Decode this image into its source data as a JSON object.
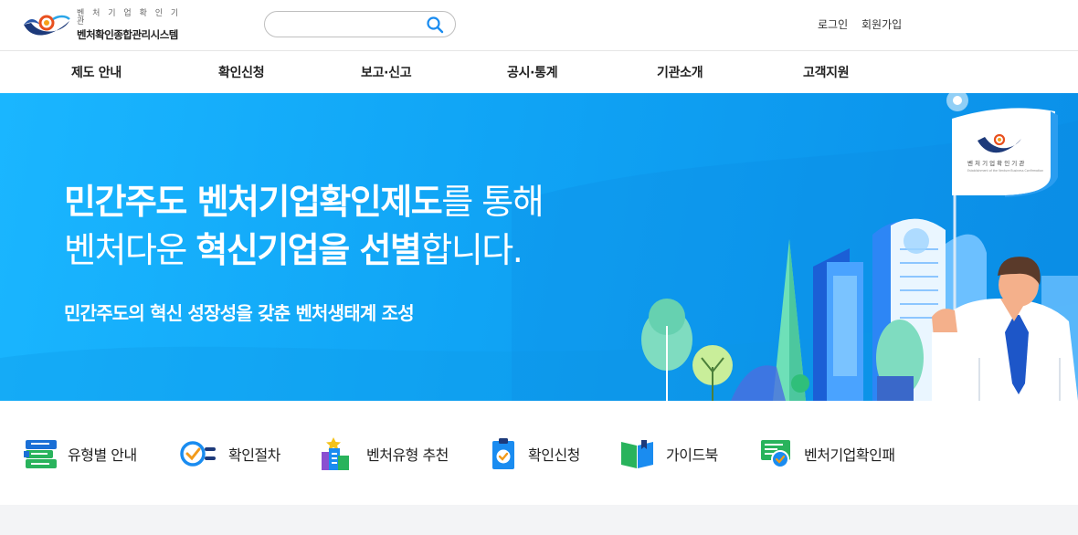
{
  "header": {
    "logo": {
      "subtitle": "벤 처 기 업 확 인 기 관",
      "title": "벤처확인종합관리시스템"
    },
    "search": {
      "placeholder": "",
      "value": ""
    },
    "util": {
      "login": "로그인",
      "signup": "회원가입"
    }
  },
  "nav": {
    "items": [
      {
        "label": "제도 안내"
      },
      {
        "label": "확인신청"
      },
      {
        "label": "보고·신고"
      },
      {
        "label": "공시·통계"
      },
      {
        "label": "기관소개"
      },
      {
        "label": "고객지원"
      }
    ]
  },
  "banner": {
    "line1_bold": "민간주도 벤처기업확인제도",
    "line1_rest": "를 통해",
    "line2_start": "벤처다운 ",
    "line2_bold": "혁신기업을 선별",
    "line2_rest": "합니다.",
    "subline": "민간주도의 혁신 성장성을 갖춘 벤처생태계 조성",
    "flag": {
      "org": "벤 처 기 업 확 인 기 관",
      "caption": "Establishment of the Venture Business Confirmation"
    }
  },
  "quick_menu": {
    "items": [
      {
        "label": "유형별 안내",
        "icon": "list-icon"
      },
      {
        "label": "확인절차",
        "icon": "check-process-icon"
      },
      {
        "label": "벤처유형 추천",
        "icon": "building-star-icon"
      },
      {
        "label": "확인신청",
        "icon": "clipboard-check-icon"
      },
      {
        "label": "가이드북",
        "icon": "book-icon"
      },
      {
        "label": "벤처기업확인패",
        "icon": "certificate-icon"
      }
    ]
  },
  "colors": {
    "banner_blue": "#10a4f5",
    "accent_blue": "#1a8cf0",
    "logo_red": "#e8501f",
    "logo_navy": "#1d3a7a"
  }
}
